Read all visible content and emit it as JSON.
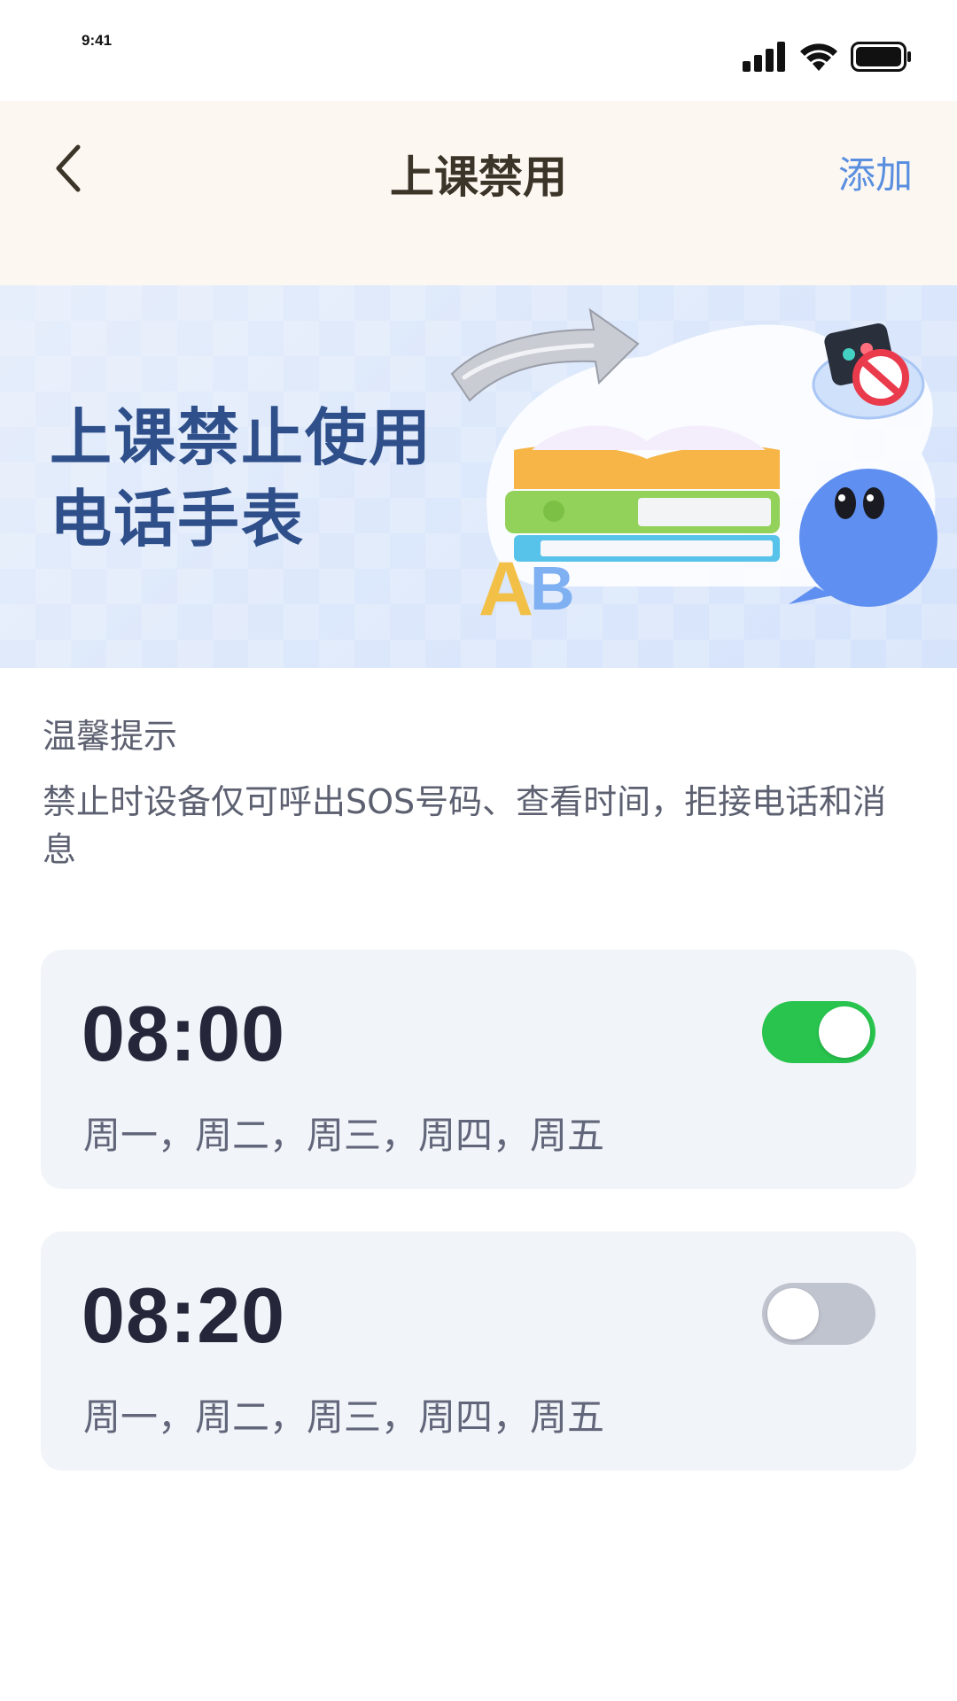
{
  "status_bar": {
    "time": "9:41"
  },
  "header": {
    "title": "上课禁用",
    "add_label": "添加"
  },
  "banner": {
    "line1": "上课禁止使用",
    "line2": "电话手表"
  },
  "tips": {
    "title": "温馨提示",
    "body": "禁止时设备仅可呼出SOS号码、查看时间，拒接电话和消息"
  },
  "schedules": [
    {
      "time": "08:00",
      "days": "周一，周二，周三，周四，周五",
      "enabled": true
    },
    {
      "time": "08:20",
      "days": "周一，周二，周三，周四，周五",
      "enabled": false
    }
  ],
  "colors": {
    "header_bg": "#fdf7f2",
    "accent_link": "#5a8fe0",
    "toggle_on": "#28c44e",
    "toggle_off": "#c0c4cf",
    "card_bg": "#f1f4f8",
    "banner_text": "#2e4f8a"
  },
  "icons": {
    "back": "chevron-left-icon",
    "signal": "cellular-signal-icon",
    "wifi": "wifi-icon",
    "battery": "battery-icon"
  }
}
